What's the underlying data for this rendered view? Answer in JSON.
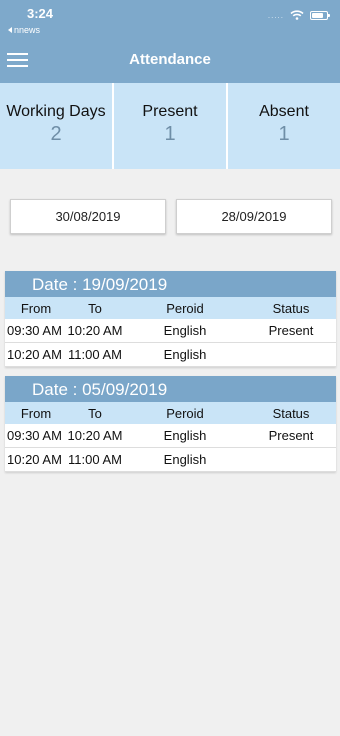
{
  "status_bar": {
    "time": "3:24",
    "back_app": "nnews",
    "signal": "....."
  },
  "header": {
    "title": "Attendance"
  },
  "stats": [
    {
      "label": "Working Days",
      "value": "2"
    },
    {
      "label": "Present",
      "value": "1"
    },
    {
      "label": "Absent",
      "value": "1"
    }
  ],
  "date_range": {
    "from": "30/08/2019",
    "to": "28/09/2019"
  },
  "table_columns": {
    "from": "From",
    "to": "To",
    "period": "Peroid",
    "status": "Status"
  },
  "days": [
    {
      "title": "Date : 19/09/2019",
      "rows": [
        {
          "from": "09:30 AM",
          "to": "10:20 AM",
          "period": "English",
          "status": "Present"
        },
        {
          "from": "10:20 AM",
          "to": "11:00 AM",
          "period": "English",
          "status": ""
        }
      ]
    },
    {
      "title": "Date : 05/09/2019",
      "rows": [
        {
          "from": "09:30 AM",
          "to": "10:20 AM",
          "period": "English",
          "status": "Present"
        },
        {
          "from": "10:20 AM",
          "to": "11:00 AM",
          "period": "English",
          "status": ""
        }
      ]
    }
  ],
  "colors": {
    "header": "#7ea9cb",
    "stat_bg": "#c9e4f7",
    "stat_value": "#6f8ea7",
    "card_head": "#7aa6c9"
  }
}
